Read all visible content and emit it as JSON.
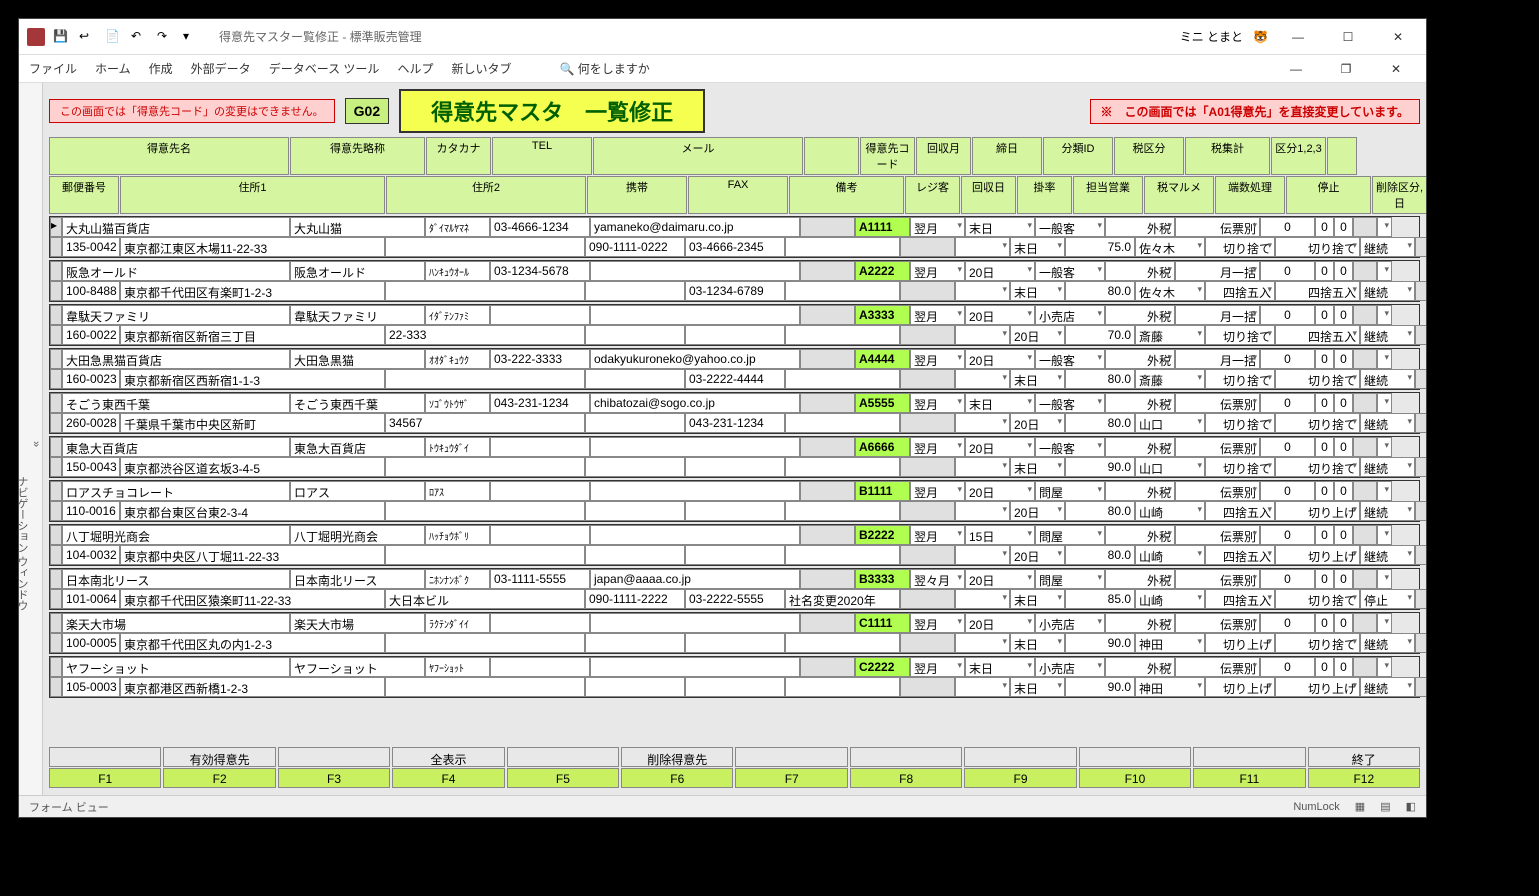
{
  "window": {
    "title": "得意先マスター覧修正 - 標準販売管理",
    "user": "ミニ とまと"
  },
  "menu": {
    "file": "ファイル",
    "home": "ホーム",
    "create": "作成",
    "external": "外部データ",
    "dbtools": "データベース ツール",
    "help": "ヘルプ",
    "newtab": "新しいタブ",
    "search": "何をしますか"
  },
  "nav": {
    "label": "ナビゲーション ウィンドウ"
  },
  "banners": {
    "pink": "この画面では「得意先コード」の変更はできません。",
    "code": "G02",
    "title": "得意先マスタ　一覧修正",
    "warn": "※　この画面では「A01得意先」を直接変更しています。"
  },
  "headers1": [
    "得意先名",
    "得意先略称",
    "カタカナ",
    "TEL",
    "メール",
    "",
    "得意先コード",
    "回収月",
    "締日",
    "分類ID",
    "税区分",
    "税集計",
    "区分1,2,3",
    ""
  ],
  "headers2": [
    "郵便番号",
    "住所1",
    "住所2",
    "携帯",
    "FAX",
    "備考",
    "レジ客",
    "回収日",
    "掛率",
    "担当営業",
    "税マルメ",
    "端数処理",
    "停止",
    "削除区分,日"
  ],
  "rows": [
    {
      "name": "大丸山猫百貨店",
      "abbr": "大丸山猫",
      "kana": "ﾀﾞｲﾏﾙﾔﾏﾈ",
      "tel": "03-4666-1234",
      "mail": "yamaneko@daimaru.co.jp",
      "code": "A1111",
      "m1": "翌月",
      "m2": "末日",
      "cls": "一般客",
      "tax": "外税",
      "agg": "伝票別",
      "k1": "0",
      "k2": "0",
      "k3": "0",
      "zip": "135-0042",
      "addr1": "東京都江東区木場11-22-33",
      "addr2": "",
      "mobile": "090-1111-0222",
      "fax": "03-4666-2345",
      "memo": "",
      "reg": "",
      "d1": "末日",
      "rate": "75.0",
      "staff": "佐々木",
      "round": "切り捨て",
      "frac": "切り捨て",
      "stop": "継続"
    },
    {
      "name": "阪急オールド",
      "abbr": "阪急オールド",
      "kana": "ﾊﾝｷｭｳｵｰﾙ",
      "tel": "03-1234-5678",
      "mail": "",
      "code": "A2222",
      "m1": "翌月",
      "m2": "20日",
      "cls": "一般客",
      "tax": "外税",
      "agg": "月一括",
      "k1": "0",
      "k2": "0",
      "k3": "0",
      "zip": "100-8488",
      "addr1": "東京都千代田区有楽町1-2-3",
      "addr2": "",
      "mobile": "",
      "fax": "03-1234-6789",
      "memo": "",
      "reg": "",
      "d1": "末日",
      "rate": "80.0",
      "staff": "佐々木",
      "round": "四捨五入",
      "frac": "四捨五入",
      "stop": "継続"
    },
    {
      "name": "韋駄天ファミリ",
      "abbr": "韋駄天ファミリ",
      "kana": "ｲﾀﾞﾃﾝﾌｧﾐ",
      "tel": "",
      "mail": "",
      "code": "A3333",
      "m1": "翌月",
      "m2": "20日",
      "cls": "小売店",
      "tax": "外税",
      "agg": "月一括",
      "k1": "0",
      "k2": "0",
      "k3": "0",
      "zip": "160-0022",
      "addr1": "東京都新宿区新宿三丁目",
      "addr2": "22-333",
      "mobile": "",
      "fax": "",
      "memo": "",
      "reg": "",
      "d1": "20日",
      "rate": "70.0",
      "staff": "斎藤",
      "round": "切り捨て",
      "frac": "四捨五入",
      "stop": "継続"
    },
    {
      "name": "大田急黒猫百貨店",
      "abbr": "大田急黒猫",
      "kana": "ｵｵﾀﾞｷｭｳｸ",
      "tel": "03-222-3333",
      "mail": "odakyukuroneko@yahoo.co.jp",
      "code": "A4444",
      "m1": "翌月",
      "m2": "20日",
      "cls": "一般客",
      "tax": "外税",
      "agg": "月一括",
      "k1": "0",
      "k2": "0",
      "k3": "0",
      "zip": "160-0023",
      "addr1": "東京都新宿区西新宿1-1-3",
      "addr2": "",
      "mobile": "",
      "fax": "03-2222-4444",
      "memo": "",
      "reg": "",
      "d1": "末日",
      "rate": "80.0",
      "staff": "斎藤",
      "round": "切り捨て",
      "frac": "切り捨て",
      "stop": "継続"
    },
    {
      "name": "そごう東西千葉",
      "abbr": "そごう東西千葉",
      "kana": "ｿｺﾞｳﾄｳｻﾞ",
      "tel": "043-231-1234",
      "mail": "chibatozai@sogo.co.jp",
      "code": "A5555",
      "m1": "翌月",
      "m2": "末日",
      "cls": "一般客",
      "tax": "外税",
      "agg": "伝票別",
      "k1": "0",
      "k2": "0",
      "k3": "0",
      "zip": "260-0028",
      "addr1": "千葉県千葉市中央区新町",
      "addr2": "34567",
      "mobile": "",
      "fax": "043-231-1234",
      "memo": "",
      "reg": "",
      "d1": "20日",
      "rate": "80.0",
      "staff": "山口",
      "round": "切り捨て",
      "frac": "切り捨て",
      "stop": "継続"
    },
    {
      "name": "東急大百貨店",
      "abbr": "東急大百貨店",
      "kana": "ﾄｳｷｭｳﾀﾞｲ",
      "tel": "",
      "mail": "",
      "code": "A6666",
      "m1": "翌月",
      "m2": "20日",
      "cls": "一般客",
      "tax": "外税",
      "agg": "伝票別",
      "k1": "0",
      "k2": "0",
      "k3": "0",
      "zip": "150-0043",
      "addr1": "東京都渋谷区道玄坂3-4-5",
      "addr2": "",
      "mobile": "",
      "fax": "",
      "memo": "",
      "reg": "",
      "d1": "末日",
      "rate": "90.0",
      "staff": "山口",
      "round": "切り捨て",
      "frac": "切り捨て",
      "stop": "継続"
    },
    {
      "name": "ロアスチョコレート",
      "abbr": "ロアス",
      "kana": "ﾛｱｽ",
      "tel": "",
      "mail": "",
      "code": "B1111",
      "m1": "翌月",
      "m2": "20日",
      "cls": "問屋",
      "tax": "外税",
      "agg": "伝票別",
      "k1": "0",
      "k2": "0",
      "k3": "0",
      "zip": "110-0016",
      "addr1": "東京都台東区台東2-3-4",
      "addr2": "",
      "mobile": "",
      "fax": "",
      "memo": "",
      "reg": "",
      "d1": "20日",
      "rate": "80.0",
      "staff": "山崎",
      "round": "四捨五入",
      "frac": "切り上げ",
      "stop": "継続"
    },
    {
      "name": "八丁堀明光商会",
      "abbr": "八丁堀明光商会",
      "kana": "ﾊｯﾁｮｳﾎﾞﾘ",
      "tel": "",
      "mail": "",
      "code": "B2222",
      "m1": "翌月",
      "m2": "15日",
      "cls": "問屋",
      "tax": "外税",
      "agg": "伝票別",
      "k1": "0",
      "k2": "0",
      "k3": "0",
      "zip": "104-0032",
      "addr1": "東京都中央区八丁堀11-22-33",
      "addr2": "",
      "mobile": "",
      "fax": "",
      "memo": "",
      "reg": "",
      "d1": "20日",
      "rate": "80.0",
      "staff": "山崎",
      "round": "四捨五入",
      "frac": "切り上げ",
      "stop": "継続"
    },
    {
      "name": "日本南北リース",
      "abbr": "日本南北リース",
      "kana": "ﾆﾎﾝﾅﾝﾎﾞｸ",
      "tel": "03-1111-5555",
      "mail": "japan@aaaa.co.jp",
      "code": "B3333",
      "m1": "翌々月",
      "m2": "20日",
      "cls": "問屋",
      "tax": "外税",
      "agg": "伝票別",
      "k1": "0",
      "k2": "0",
      "k3": "0",
      "zip": "101-0064",
      "addr1": "東京都千代田区猿楽町11-22-33",
      "addr2": "大日本ビル",
      "mobile": "090-1111-2222",
      "fax": "03-2222-5555",
      "memo": "社名変更2020年",
      "reg": "",
      "d1": "末日",
      "rate": "85.0",
      "staff": "山崎",
      "round": "四捨五入",
      "frac": "切り捨て",
      "stop": "停止"
    },
    {
      "name": "楽天大市場",
      "abbr": "楽天大市場",
      "kana": "ﾗｸﾃﾝﾀﾞｲｲ",
      "tel": "",
      "mail": "",
      "code": "C1111",
      "m1": "翌月",
      "m2": "20日",
      "cls": "小売店",
      "tax": "外税",
      "agg": "伝票別",
      "k1": "0",
      "k2": "0",
      "k3": "0",
      "zip": "100-0005",
      "addr1": "東京都千代田区丸の内1-2-3",
      "addr2": "",
      "mobile": "",
      "fax": "",
      "memo": "",
      "reg": "",
      "d1": "末日",
      "rate": "90.0",
      "staff": "神田",
      "round": "切り上げ",
      "frac": "切り捨て",
      "stop": "継続"
    },
    {
      "name": "ヤフーショット",
      "abbr": "ヤフーショット",
      "kana": "ﾔﾌｰｼｮｯﾄ",
      "tel": "",
      "mail": "",
      "code": "C2222",
      "m1": "翌月",
      "m2": "末日",
      "cls": "小売店",
      "tax": "外税",
      "agg": "伝票別",
      "k1": "0",
      "k2": "0",
      "k3": "0",
      "zip": "105-0003",
      "addr1": "東京都港区西新橋1-2-3",
      "addr2": "",
      "mobile": "",
      "fax": "",
      "memo": "",
      "reg": "",
      "d1": "末日",
      "rate": "90.0",
      "staff": "神田",
      "round": "切り上げ",
      "frac": "切り上げ",
      "stop": "継続"
    }
  ],
  "footer": {
    "labels": [
      "",
      "有効得意先",
      "",
      "全表示",
      "",
      "削除得意先",
      "",
      "",
      "",
      "",
      "",
      "終了"
    ],
    "fkeys": [
      "F1",
      "F2",
      "F3",
      "F4",
      "F5",
      "F6",
      "F7",
      "F8",
      "F9",
      "F10",
      "F11",
      "F12"
    ]
  },
  "status": {
    "left": "フォーム ビュー",
    "numlock": "NumLock"
  }
}
